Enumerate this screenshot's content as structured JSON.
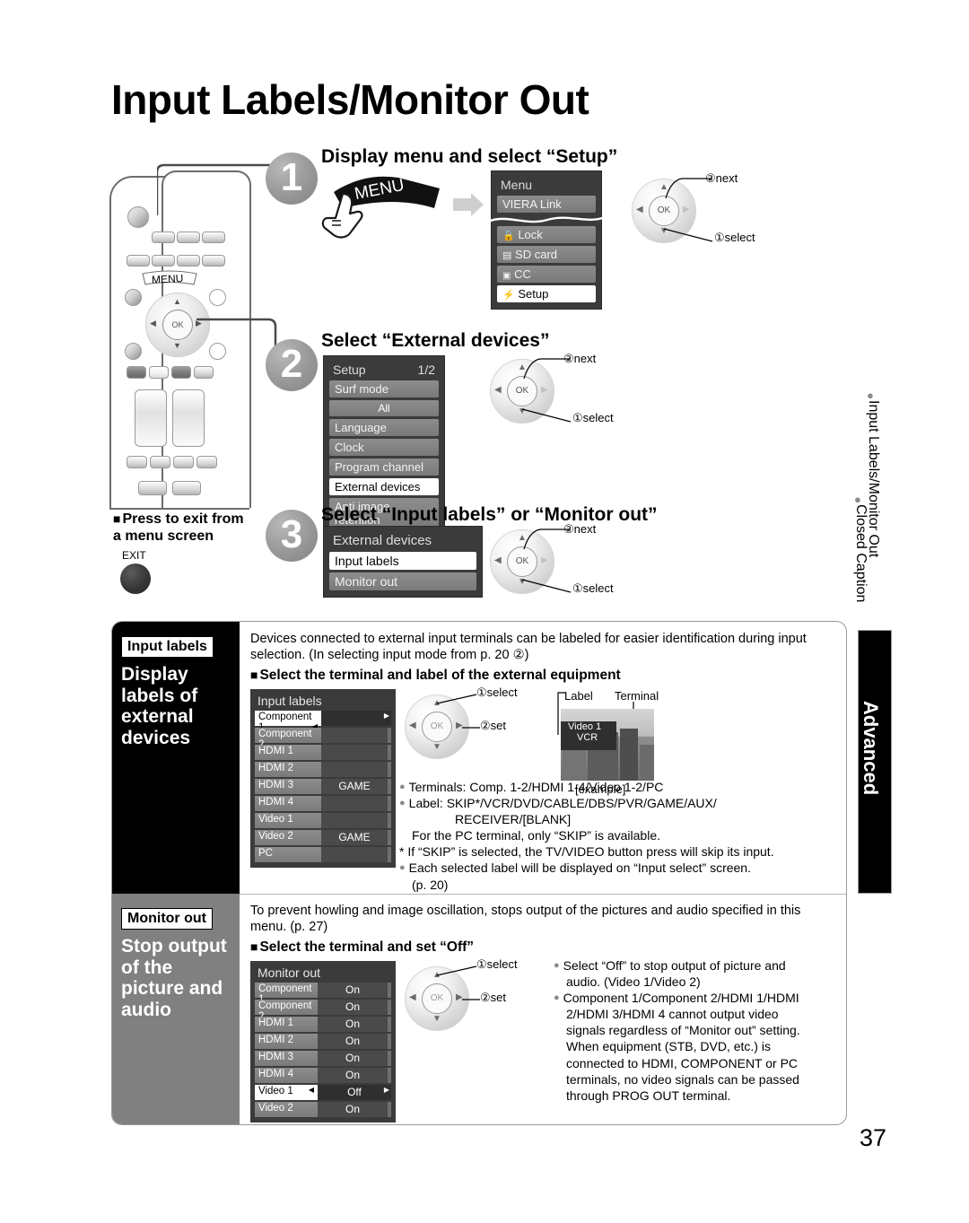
{
  "page": {
    "title": "Input Labels/Monitor Out",
    "number": "37"
  },
  "steps": [
    {
      "num": "1",
      "heading": "Display menu and select “Setup”",
      "button": "MENU",
      "osd": {
        "title": "Menu",
        "rows": [
          {
            "label": "VIERA Link",
            "selected": false
          },
          {
            "label": "Lock",
            "icon": "lock-icon",
            "selected": false
          },
          {
            "label": "SD card",
            "icon": "sdcard-icon",
            "selected": false
          },
          {
            "label": "CC",
            "icon": "cc-icon",
            "selected": false
          },
          {
            "label": "Setup",
            "icon": "setup-icon",
            "selected": true
          }
        ]
      },
      "callouts": {
        "first": "①select",
        "second": "②next"
      }
    },
    {
      "num": "2",
      "heading": "Select “External devices”",
      "osd": {
        "title": "Setup",
        "page": "1/2",
        "rows": [
          {
            "label": "Surf mode",
            "selected": false
          },
          {
            "label": "All",
            "sub": true
          },
          {
            "label": "Language",
            "selected": false
          },
          {
            "label": "Clock",
            "selected": false
          },
          {
            "label": "Program channel",
            "selected": false
          },
          {
            "label": "External devices",
            "selected": true
          },
          {
            "label": "Anti image retention",
            "selected": false
          }
        ]
      },
      "callouts": {
        "first": "①select",
        "second": "②next"
      }
    },
    {
      "num": "3",
      "heading": "Select “Input labels” or “Monitor out”",
      "osd": {
        "title": "External devices",
        "rows": [
          {
            "label": "Input labels",
            "selected": true
          },
          {
            "label": "Monitor out",
            "selected": false
          }
        ]
      },
      "callouts": {
        "first": "①select",
        "second": "②next"
      }
    }
  ],
  "exit_note": {
    "line1": "Press to exit from",
    "line2": "a menu screen",
    "button": "EXIT"
  },
  "remote": {
    "menu_label": "MENU",
    "ok_label": "OK"
  },
  "sections": [
    {
      "badge": "Input labels",
      "subtitle": "Display\nlabels of\nexternal\ndevices",
      "intro": "Devices connected to external input terminals can be labeled for easier identification during input selection. (In selecting input mode from p. 20 ②)",
      "heading": "Select the terminal and label of the external equipment",
      "table": {
        "title": "Input labels",
        "rows": [
          {
            "name": "Component 1",
            "value": "",
            "selected": true
          },
          {
            "name": "Component 2",
            "value": "",
            "selected": false
          },
          {
            "name": "HDMI 1",
            "value": "",
            "selected": false
          },
          {
            "name": "HDMI 2",
            "value": "",
            "selected": false
          },
          {
            "name": "HDMI 3",
            "value": "GAME",
            "selected": false
          },
          {
            "name": "HDMI 4",
            "value": "",
            "selected": false
          },
          {
            "name": "Video 1",
            "value": "",
            "selected": false
          },
          {
            "name": "Video 2",
            "value": "GAME",
            "selected": false
          },
          {
            "name": "PC",
            "value": "",
            "selected": false
          }
        ]
      },
      "callouts": {
        "first": "①select",
        "second": "②set"
      },
      "example": {
        "label_caption": "Label",
        "terminal_caption": "Terminal",
        "terminal_value": "Video 1",
        "label_value": "VCR",
        "caption": "[example]"
      },
      "notes": [
        {
          "bullet": "dot",
          "text": "Terminals:  Comp. 1-2/HDMI 1-4/Video 1-2/PC"
        },
        {
          "bullet": "dot",
          "text": "Label:  SKIP*/VCR/DVD/CABLE/DBS/PVR/GAME/AUX/"
        },
        {
          "bullet": "none",
          "text": "RECEIVER/[BLANK]",
          "indent": 2
        },
        {
          "bullet": "none",
          "text": "For the PC terminal, only “SKIP” is available.",
          "indent": 1
        },
        {
          "bullet": "star",
          "text": "If “SKIP” is selected, the TV/VIDEO button press will skip its input."
        },
        {
          "bullet": "dot",
          "text": "Each selected label will be displayed on “Input select” screen."
        },
        {
          "bullet": "none",
          "text": "(p. 20)",
          "indent": 1
        }
      ]
    },
    {
      "badge": "Monitor out",
      "subtitle": "Stop output\nof the\npicture and\naudio",
      "intro": "To prevent howling and image oscillation, stops output of the pictures and audio specified in this menu. (p. 27)",
      "heading": "Select the terminal and set “Off”",
      "table": {
        "title": "Monitor out",
        "rows": [
          {
            "name": "Component 1",
            "value": "On",
            "selected": false
          },
          {
            "name": "Component 2",
            "value": "On",
            "selected": false
          },
          {
            "name": "HDMI 1",
            "value": "On",
            "selected": false
          },
          {
            "name": "HDMI 2",
            "value": "On",
            "selected": false
          },
          {
            "name": "HDMI 3",
            "value": "On",
            "selected": false
          },
          {
            "name": "HDMI 4",
            "value": "On",
            "selected": false
          },
          {
            "name": "Video 1",
            "value": "Off",
            "selected": true
          },
          {
            "name": "Video 2",
            "value": "On",
            "selected": false
          }
        ]
      },
      "callouts": {
        "first": "①select",
        "second": "②set"
      },
      "notes": [
        {
          "bullet": "dot",
          "text": "Select “Off” to stop output of picture and"
        },
        {
          "bullet": "none",
          "text": "audio. (Video 1/Video 2)",
          "indent": 1
        },
        {
          "bullet": "dot",
          "text": "Component 1/Component 2/HDMI 1/HDMI"
        },
        {
          "bullet": "none",
          "text": "2/HDMI 3/HDMI 4 cannot output video",
          "indent": 1
        },
        {
          "bullet": "none",
          "text": "signals regardless of “Monitor out” setting.",
          "indent": 1
        },
        {
          "bullet": "none",
          "text": "When equipment (STB, DVD, etc.) is",
          "indent": 1
        },
        {
          "bullet": "none",
          "text": "connected to HDMI, COMPONENT or PC",
          "indent": 1
        },
        {
          "bullet": "none",
          "text": "terminals, no video signals can be passed",
          "indent": 1
        },
        {
          "bullet": "none",
          "text": "through PROG OUT terminal.",
          "indent": 1
        }
      ]
    }
  ],
  "side_index": {
    "items": [
      "Input Labels/Monitor Out",
      "Closed Caption"
    ],
    "tab": "Advanced"
  }
}
